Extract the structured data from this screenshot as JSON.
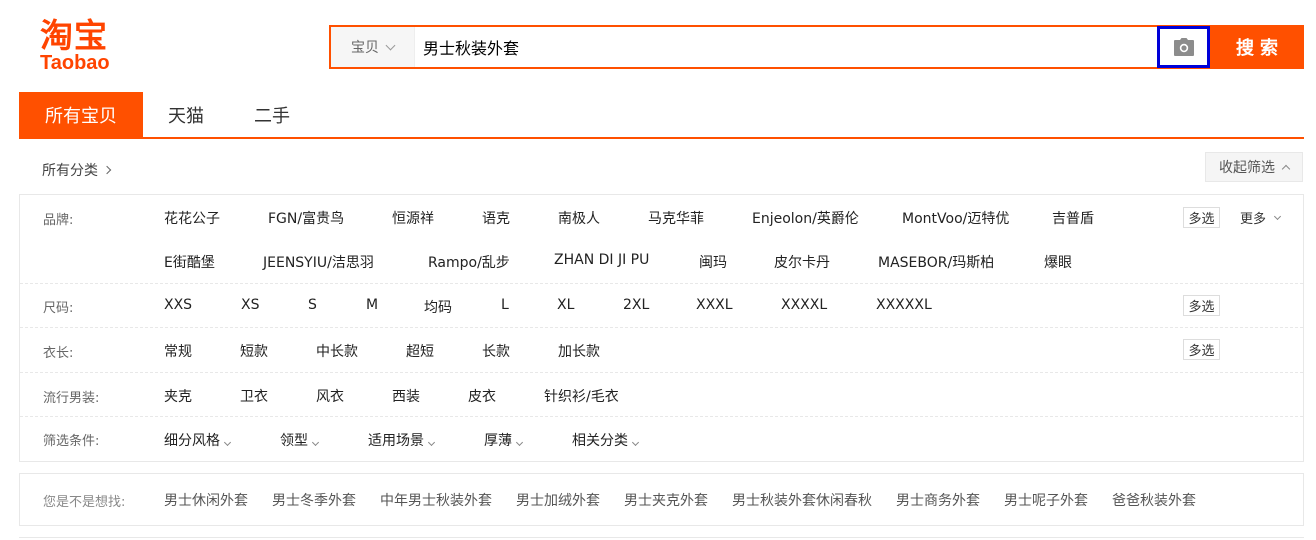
{
  "logo": {
    "cn": "淘宝",
    "en": "Taobao"
  },
  "search": {
    "scope": "宝贝",
    "query": "男士秋装外套",
    "button": "搜索",
    "camera_icon": "camera-icon"
  },
  "tabs": [
    "所有宝贝",
    "天猫",
    "二手"
  ],
  "crumb": "所有分类",
  "collapse": "收起筛选",
  "filters": {
    "brand": {
      "label": "品牌:",
      "row1": [
        "花花公子",
        "FGN/富贵鸟",
        "恒源祥",
        "语克",
        "南极人",
        "马克华菲",
        "Enjeolon/英爵伦",
        "MontVoo/迈特优",
        "吉普盾"
      ],
      "row2": [
        "E街酷堡",
        "JEENSYIU/洁思羽",
        "Rampo/乱步",
        "ZHAN DI JI PU",
        "闽玛",
        "皮尔卡丹",
        "MASEBOR/玛斯柏",
        "爆眼"
      ],
      "multi": "多选",
      "more": "更多"
    },
    "size": {
      "label": "尺码:",
      "items": [
        "XXS",
        "XS",
        "S",
        "M",
        "均码",
        "L",
        "XL",
        "2XL",
        "XXXL",
        "XXXXL",
        "XXXXXL"
      ],
      "multi": "多选"
    },
    "length": {
      "label": "衣长:",
      "items": [
        "常规",
        "短款",
        "中长款",
        "超短",
        "长款",
        "加长款"
      ],
      "multi": "多选"
    },
    "style": {
      "label": "流行男装:",
      "items": [
        "夹克",
        "卫衣",
        "风衣",
        "西装",
        "皮衣",
        "针织衫/毛衣"
      ]
    },
    "conditions": {
      "label": "筛选条件:",
      "items": [
        "细分风格",
        "领型",
        "适用场景",
        "厚薄",
        "相关分类"
      ]
    }
  },
  "suggest": {
    "label": "您是不是想找:",
    "items": [
      "男士休闲外套",
      "男士冬季外套",
      "中年男士秋装外套",
      "男士加绒外套",
      "男士夹克外套",
      "男士秋装外套休闲春秋",
      "男士商务外套",
      "男士呢子外套",
      "爸爸秋装外套"
    ]
  }
}
